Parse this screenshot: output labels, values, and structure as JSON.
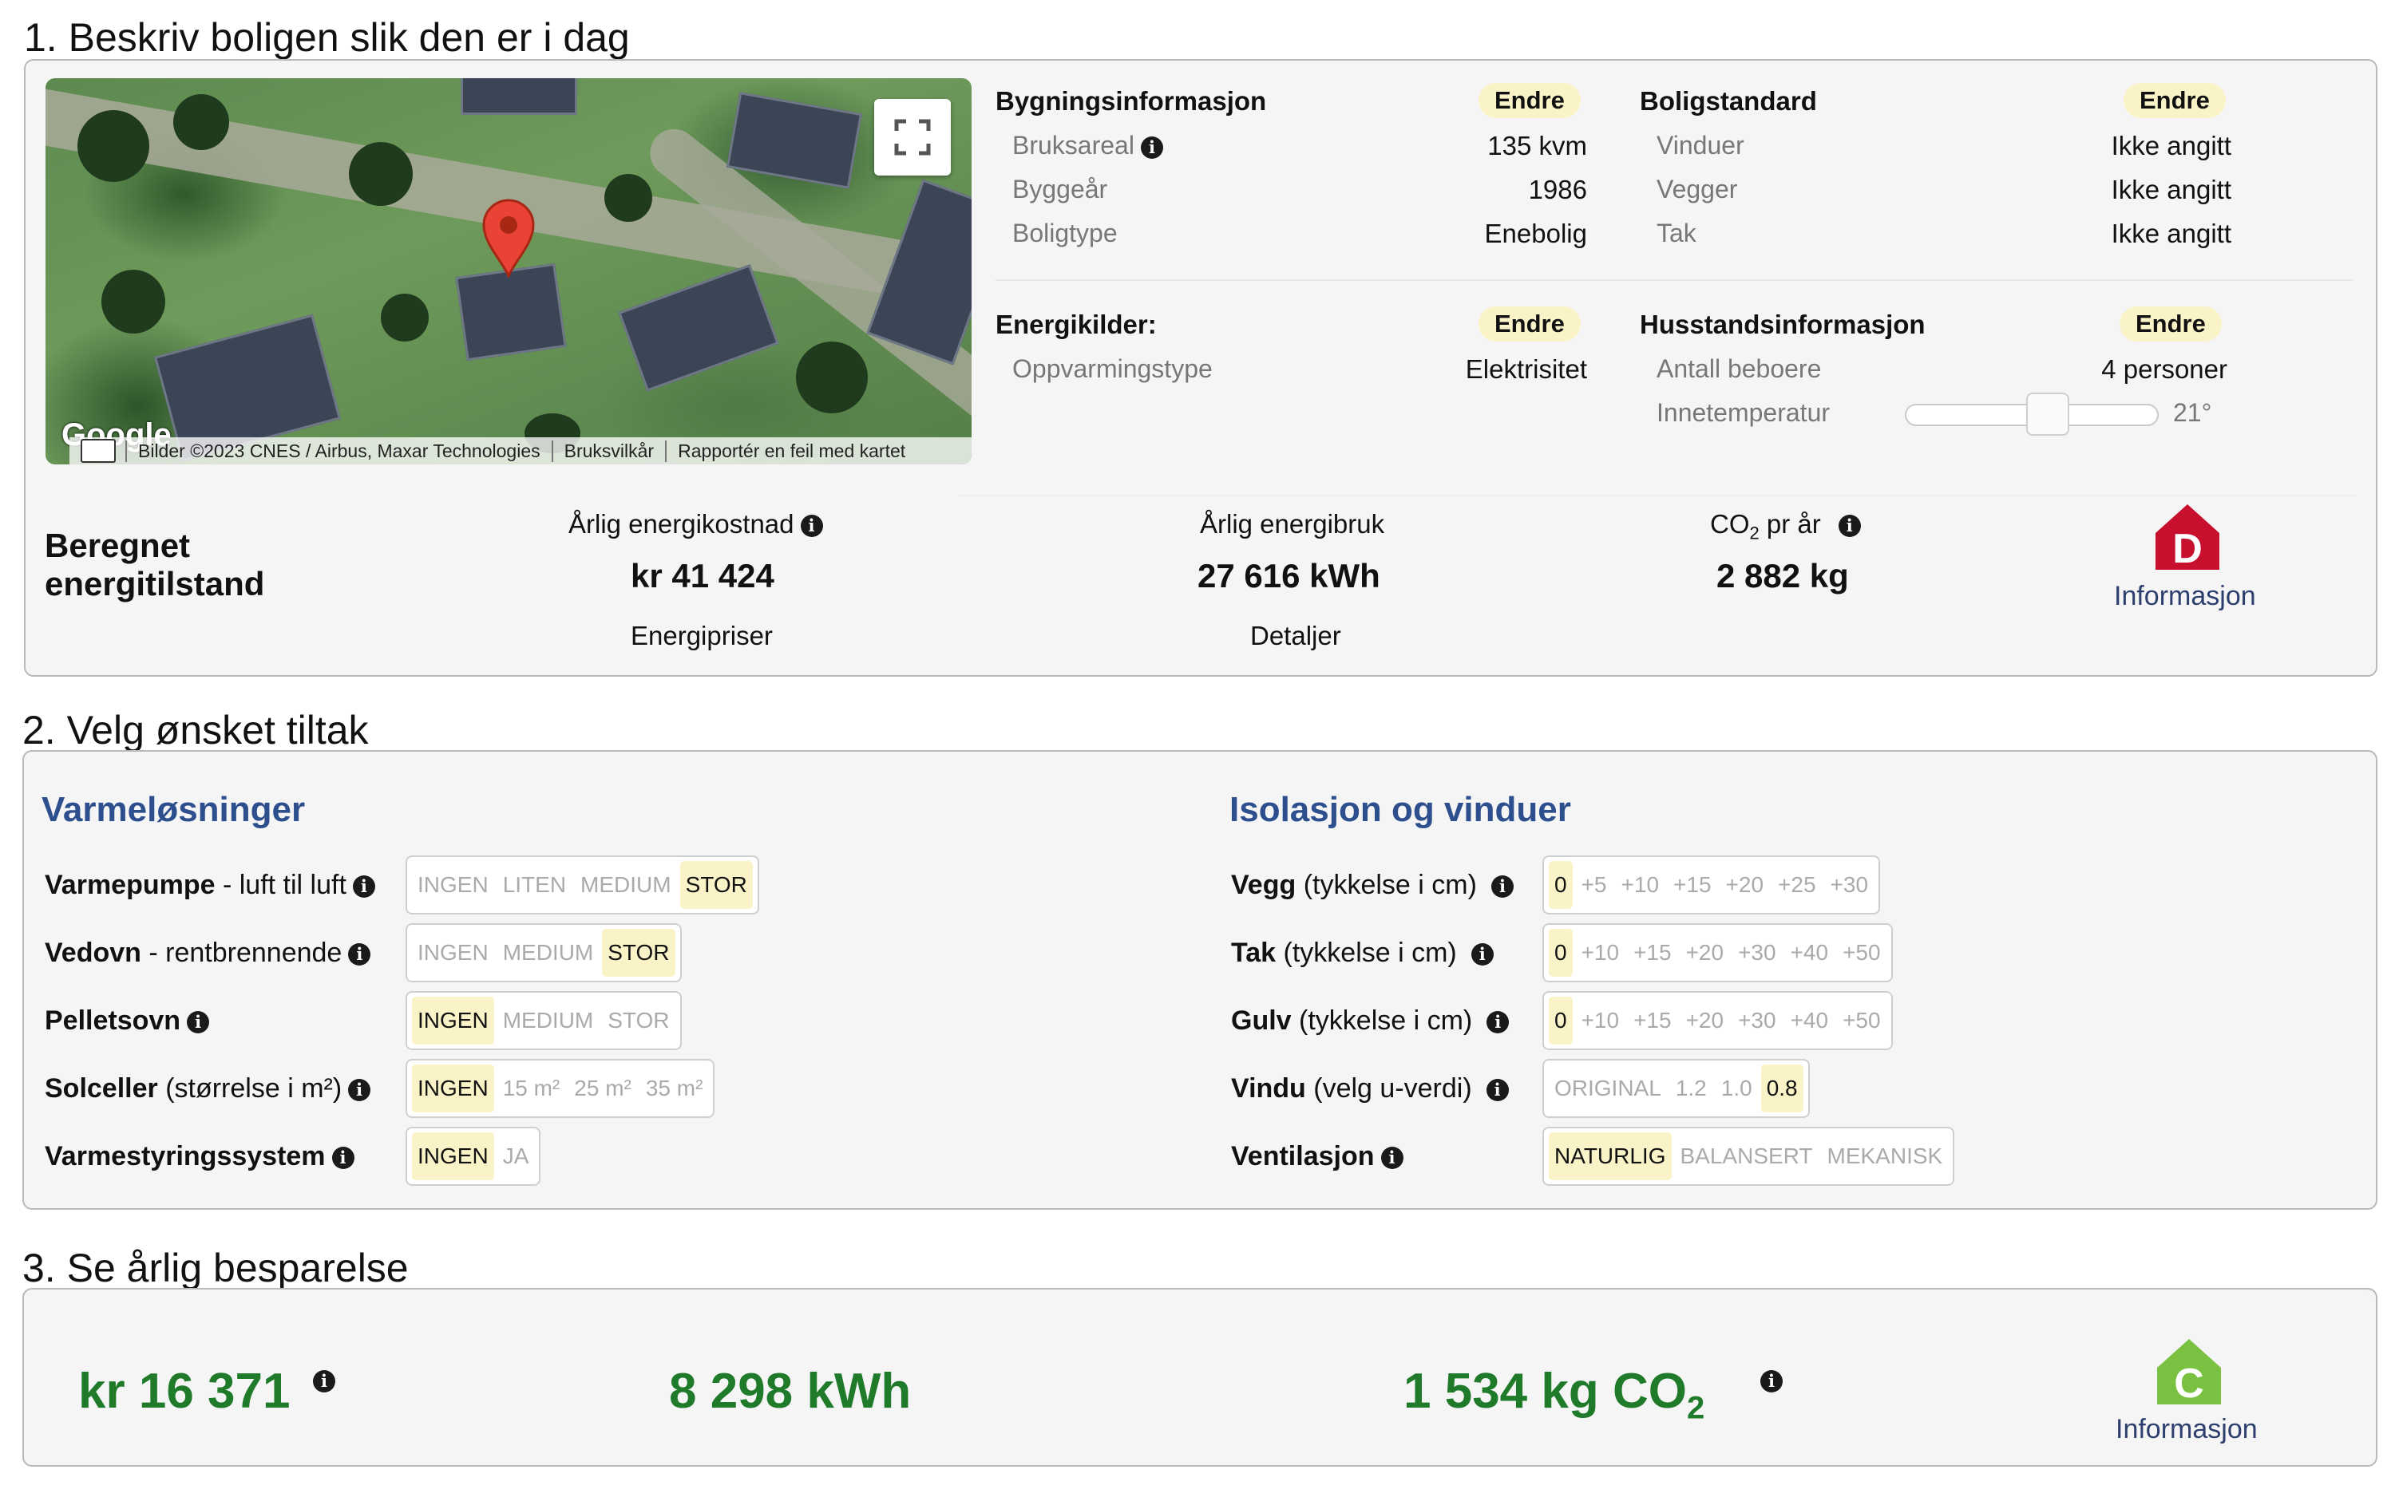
{
  "sections": {
    "s1": "1. Beskriv boligen slik den er i dag",
    "s2": "2. Velg ønsket tiltak",
    "s3": "3. Se årlig besparelse"
  },
  "map": {
    "attribution_imagery": "Bilder ©2023 CNES / Airbus, Maxar Technologies",
    "attribution_terms": "Bruksvilkår",
    "attribution_report": "Rapportér en feil med kartet",
    "logo": "Google"
  },
  "endre_label": "Endre",
  "building": {
    "title": "Bygningsinformasjon",
    "rows": [
      {
        "label": "Bruksareal",
        "value": "135 kvm"
      },
      {
        "label": "Byggeår",
        "value": "1986"
      },
      {
        "label": "Boligtype",
        "value": "Enebolig"
      }
    ]
  },
  "standard": {
    "title": "Boligstandard",
    "rows": [
      {
        "label": "Vinduer",
        "value": "Ikke angitt"
      },
      {
        "label": "Vegger",
        "value": "Ikke angitt"
      },
      {
        "label": "Tak",
        "value": "Ikke angitt"
      }
    ]
  },
  "energy_sources": {
    "title": "Energikilder:",
    "rows": [
      {
        "label": "Oppvarmingstype",
        "value": "Elektrisitet"
      }
    ]
  },
  "household": {
    "title": "Husstandsinformasjon",
    "residents_label": "Antall beboere",
    "residents_value": "4 personer",
    "temp_label": "Innetemperatur",
    "temp_value": "21°",
    "temp_slider_fraction": 0.6
  },
  "energy_state": {
    "title_line1": "Beregnet",
    "title_line2": "energitilstand",
    "cost_label": "Årlig energikostnad",
    "cost_value": "kr 41 424",
    "cost_link": "Energipriser",
    "use_label": "Årlig energibruk",
    "use_value": "27 616  kWh",
    "use_link": "Detaljer",
    "co2_label": "CO",
    "co2_sub": "2",
    "co2_label_tail": " pr år",
    "co2_value": "2 882  kg",
    "grade": "D",
    "grade_color": "#c8102e",
    "info_link": "Informasjon"
  },
  "heating": {
    "title": "Varmeløsninger",
    "rows": [
      {
        "bold": "Varmepumpe",
        "rest": " - luft til luft",
        "options": [
          "INGEN",
          "LITEN",
          "MEDIUM",
          "STOR"
        ],
        "selected": 3
      },
      {
        "bold": "Vedovn",
        "rest": " - rentbrennende",
        "options": [
          "INGEN",
          "MEDIUM",
          "STOR"
        ],
        "selected": 2
      },
      {
        "bold": "Pelletsovn",
        "rest": "",
        "options": [
          "INGEN",
          "MEDIUM",
          "STOR"
        ],
        "selected": 0
      },
      {
        "bold": "Solceller",
        "rest": " (størrelse i m²)",
        "options": [
          "INGEN",
          "15 m²",
          "25 m²",
          "35 m²"
        ],
        "selected": 0
      },
      {
        "bold": "Varmestyringssystem",
        "rest": "",
        "options": [
          "INGEN",
          "JA"
        ],
        "selected": 0
      }
    ]
  },
  "insulation": {
    "title": "Isolasjon og vinduer",
    "rows": [
      {
        "bold": "Vegg",
        "rest": " (tykkelse i cm)",
        "options": [
          "0",
          "+5",
          "+10",
          "+15",
          "+20",
          "+25",
          "+30"
        ],
        "selected": 0
      },
      {
        "bold": "Tak",
        "rest": " (tykkelse i cm)",
        "options": [
          "0",
          "+10",
          "+15",
          "+20",
          "+30",
          "+40",
          "+50"
        ],
        "selected": 0
      },
      {
        "bold": "Gulv",
        "rest": " (tykkelse i cm)",
        "options": [
          "0",
          "+10",
          "+15",
          "+20",
          "+30",
          "+40",
          "+50"
        ],
        "selected": 0
      },
      {
        "bold": "Vindu",
        "rest": " (velg u-verdi)",
        "options": [
          "ORIGINAL",
          "1.2",
          "1.0",
          "0.8"
        ],
        "selected": 3
      },
      {
        "bold": "Ventilasjon",
        "rest": "",
        "options": [
          "NATURLIG",
          "BALANSERT",
          "MEKANISK"
        ],
        "selected": 0
      }
    ]
  },
  "savings": {
    "cost": "kr 16 371",
    "energy": "8 298  kWh",
    "co2": "1 534  kg CO",
    "co2_sub": "2",
    "grade": "C",
    "grade_color": "#7ac142",
    "info_link": "Informasjon"
  },
  "info_glyph": "i"
}
